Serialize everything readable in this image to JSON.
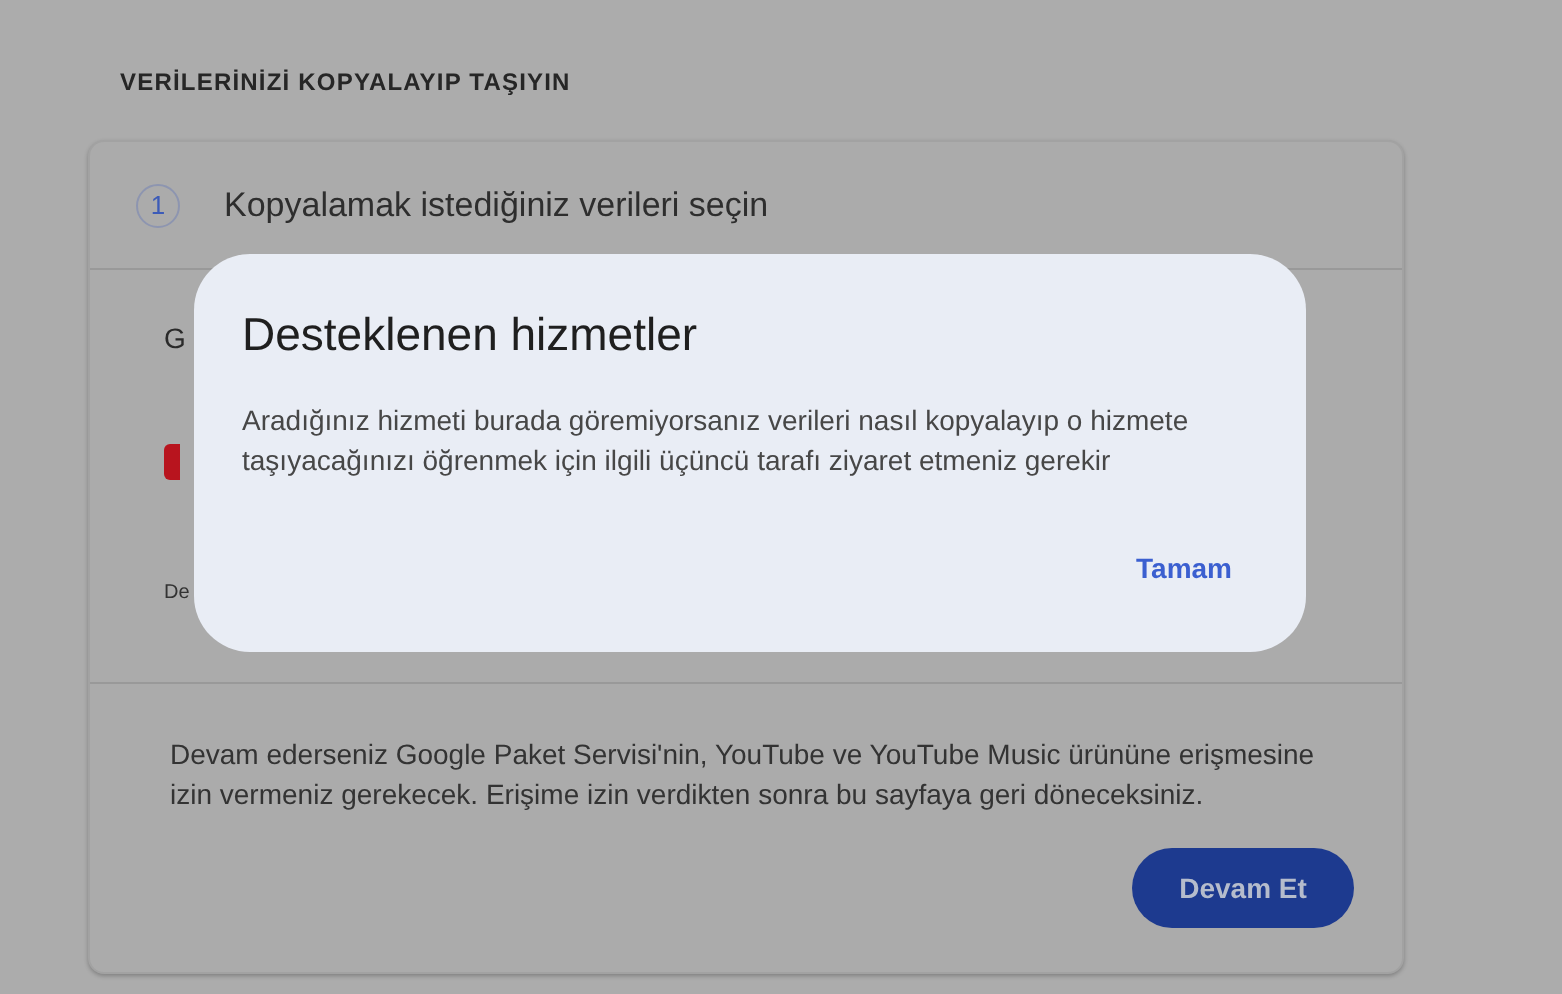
{
  "page": {
    "heading": "VERİLERİNİZİ KOPYALAYIP TAŞIYIN"
  },
  "step": {
    "number": "1",
    "title": "Kopyalamak istediğiniz verileri seçin",
    "partial_texts": [
      "G",
      "De"
    ],
    "notice": "Devam ederseniz Google Paket Servisi'nin, YouTube ve YouTube Music ürününe erişmesine izin vermeniz gerekecek. Erişime izin verdikten sonra bu sayfaya geri döneceksiniz.",
    "continue_button": "Devam Et"
  },
  "dialog": {
    "title": "Desteklenen hizmetler",
    "body": "Aradığınız hizmeti burada göremiyorsanız verileri nasıl kopyalayıp o hizmete taşıyacağınızı öğrenmek için ilgili üçüncü tarafı ziyaret etmeniz gerekir",
    "button": "Tamam"
  }
}
